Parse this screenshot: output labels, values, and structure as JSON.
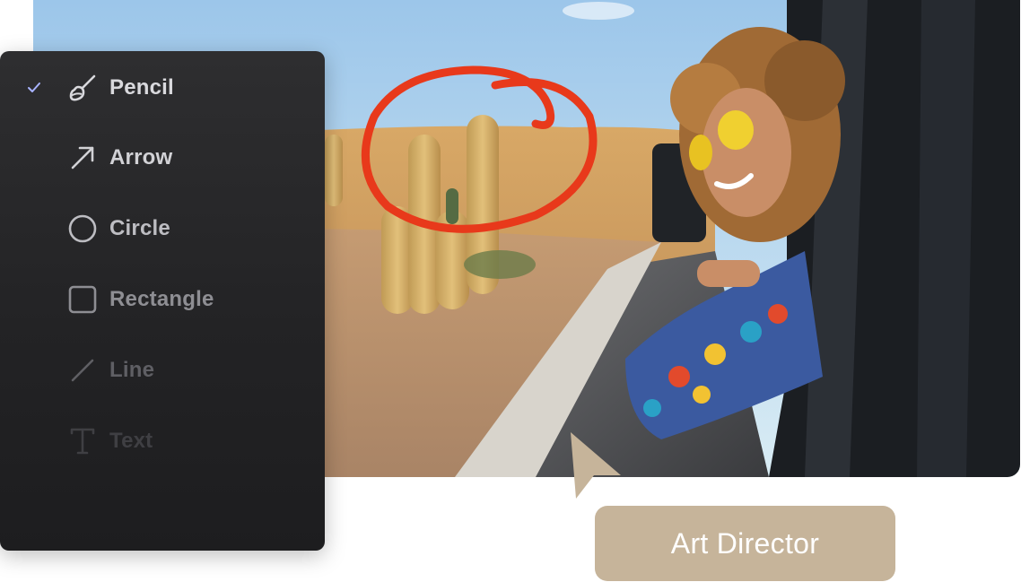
{
  "tool_menu": {
    "items": [
      {
        "label": "Pencil",
        "icon": "pencil-brush-icon",
        "selected": true,
        "color": "#d9d9dd"
      },
      {
        "label": "Arrow",
        "icon": "arrow-icon",
        "selected": false,
        "color": "#d2d2d6"
      },
      {
        "label": "Circle",
        "icon": "circle-icon",
        "selected": false,
        "color": "#bdbdc2"
      },
      {
        "label": "Rectangle",
        "icon": "rectangle-icon",
        "selected": false,
        "color": "#8e8e93"
      },
      {
        "label": "Line",
        "icon": "line-icon",
        "selected": false,
        "color": "#5f5f64"
      },
      {
        "label": "Text",
        "icon": "text-icon",
        "selected": false,
        "color": "#3f3f43"
      }
    ],
    "check_icon": "checkmark-icon",
    "check_color": "#a9b4ff"
  },
  "annotation": {
    "shape": "hand-drawn-circle",
    "color": "#e8391b"
  },
  "collaborator_tag": {
    "label": "Art Director",
    "color": "#c6b49a"
  },
  "cursor_color": "#c6b49a"
}
